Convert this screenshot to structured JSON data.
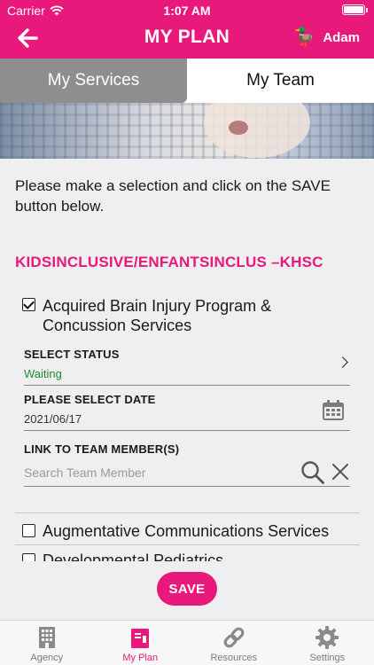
{
  "status_bar": {
    "carrier": "Carrier",
    "time": "1:07 AM"
  },
  "header": {
    "title": "MY PLAN",
    "user_name": "Adam",
    "avatar_glyph": "🦆"
  },
  "tabs": [
    {
      "label": "My Services",
      "active": false
    },
    {
      "label": "My Team",
      "active": true
    }
  ],
  "intro_text": "Please make a selection and click on the SAVE button below.",
  "agency": {
    "name": "KIDSINCLUSIVE/ENFANTSINCLUS –KHSC"
  },
  "services": [
    {
      "name": "Acquired Brain Injury Program & Concussion Services",
      "checked": true,
      "status_label": "SELECT STATUS",
      "status_value": "Waiting",
      "date_label": "PLEASE SELECT DATE",
      "date_value": "2021/06/17",
      "team_label": "LINK TO TEAM MEMBER(S)",
      "team_placeholder": "Search Team Member"
    },
    {
      "name": "Augmentative Communications Services",
      "checked": false
    },
    {
      "name": "Developmental Pediatrics",
      "checked": false
    }
  ],
  "save_label": "SAVE",
  "bottom_nav": [
    {
      "label": "Agency",
      "icon": "building-icon",
      "active": false
    },
    {
      "label": "My Plan",
      "icon": "plan-icon",
      "active": true
    },
    {
      "label": "Resources",
      "icon": "link-icon",
      "active": false
    },
    {
      "label": "Settings",
      "icon": "gear-icon",
      "active": false
    }
  ],
  "colors": {
    "brand": "#e8197a",
    "status_green": "#1d8a2a",
    "tab_inactive": "#8e8e8e"
  }
}
